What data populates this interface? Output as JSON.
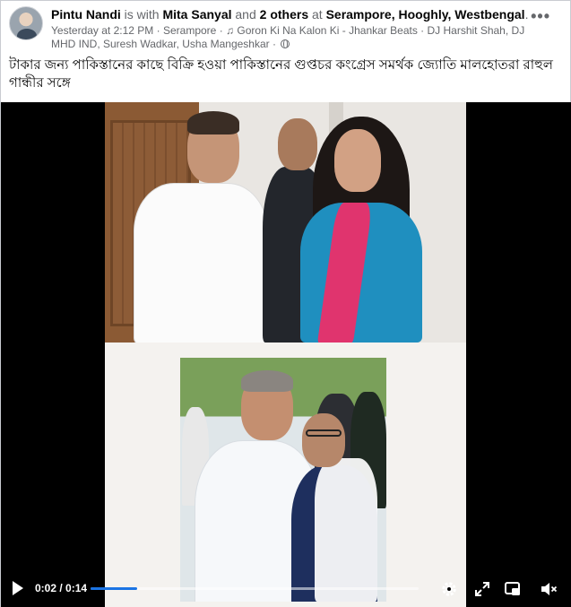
{
  "post": {
    "author": "Pintu Nandi",
    "with_text": " is with ",
    "tagged": "Mita Sanyal",
    "and_text": " and ",
    "others": "2 others",
    "at_text": " at ",
    "location": "Serampore, Hooghly, Westbengal",
    "location_end": ".",
    "timestamp": "Yesterday at 2:12 PM",
    "place": "Serampore",
    "music_note": "♫",
    "music": "Goron Ki Na Kalon Ki - Jhankar Beats · DJ Harshit Shah, DJ MHD IND, Suresh Wadkar, Usha Mangeshkar",
    "more_menu": "•••",
    "caption": "টাকার জন্য পাকিস্তানের কাছে বিক্রি হওয়া পাকিস্তানের গুপ্তচর কংগ্রেস সমর্থক জ্যোতি মালহোতরা রাহুল গান্ধীর সঙ্গে"
  },
  "video": {
    "time_current": "0:02",
    "time_separator": " / ",
    "time_total": "0:14",
    "progress_fraction": 0.143,
    "colors": {
      "progress": "#1b74e4",
      "background": "#000000"
    }
  },
  "icons": [
    "avatar",
    "globe-icon",
    "music-icon",
    "more-icon",
    "play-icon",
    "settings-icon",
    "expand-icon",
    "picture-in-picture-icon",
    "volume-muted-icon"
  ]
}
